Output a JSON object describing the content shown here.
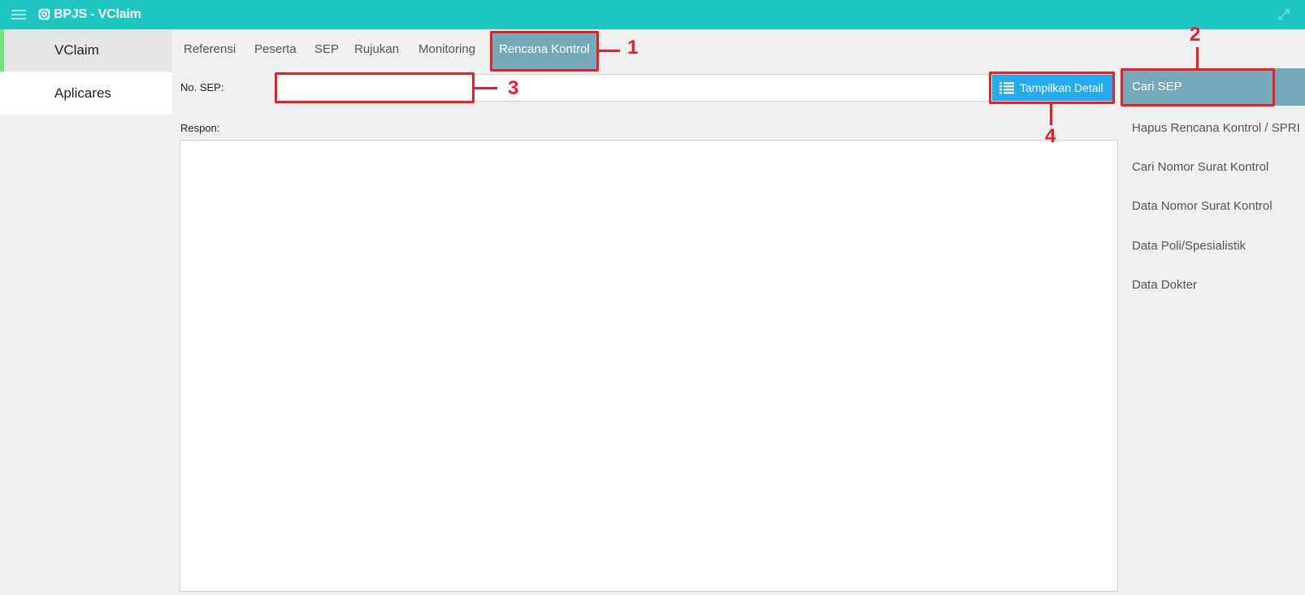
{
  "app": {
    "title": "BPJS - VClaim"
  },
  "icons": {
    "menu": "menu-icon",
    "brand": "gear-icon",
    "expand": "expand-icon",
    "detail": "list-icon"
  },
  "colors": {
    "topbar": "#1ec6c0",
    "active_tab": "#73a9b9",
    "button": "#25aaf0",
    "highlight": "#ee1c24",
    "sidebar_accent": "#76e07a"
  },
  "sidebar": {
    "items": [
      {
        "label": "VClaim"
      },
      {
        "label": "Aplicares"
      }
    ]
  },
  "tabs": [
    {
      "label": "Referensi"
    },
    {
      "label": "Peserta"
    },
    {
      "label": "SEP"
    },
    {
      "label": "Rujukan"
    },
    {
      "label": "Monitoring"
    },
    {
      "label": "Rencana Kontrol"
    }
  ],
  "form": {
    "sep_label": "No. SEP:",
    "sep_value": "",
    "detail_button": "Tampilkan Detail",
    "respon_label": "Respon:"
  },
  "right_menu": {
    "items": [
      {
        "label": "Cari SEP"
      },
      {
        "label": "Hapus Rencana Kontrol / SPRI"
      },
      {
        "label": "Cari Nomor Surat Kontrol"
      },
      {
        "label": "Data Nomor Surat Kontrol"
      },
      {
        "label": "Data Poli/Spesialistik"
      },
      {
        "label": "Data Dokter"
      }
    ]
  },
  "annotations": [
    "1",
    "2",
    "3",
    "4"
  ]
}
